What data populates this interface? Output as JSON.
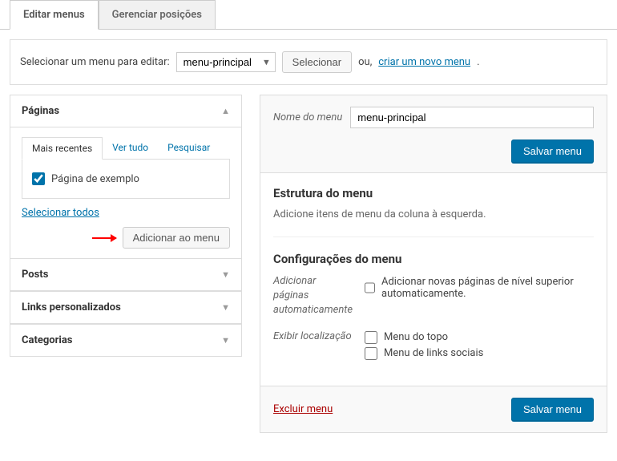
{
  "tabs": {
    "edit": "Editar menus",
    "manage": "Gerenciar posições"
  },
  "selector": {
    "label": "Selecionar um menu para editar:",
    "value": "menu-principal",
    "button": "Selecionar",
    "or": "ou,",
    "createLink": "criar um novo menu",
    "period": "."
  },
  "sidebar": {
    "pages": {
      "title": "Páginas",
      "tabs": {
        "recent": "Mais recentes",
        "all": "Ver tudo",
        "search": "Pesquisar"
      },
      "items": [
        {
          "label": "Página de exemplo"
        }
      ],
      "selectAll": "Selecionar todos",
      "addButton": "Adicionar ao menu"
    },
    "posts": "Posts",
    "customLinks": "Links personalizados",
    "categories": "Categorias"
  },
  "menu": {
    "nameLabel": "Nome do menu",
    "nameValue": "menu-principal",
    "saveButton": "Salvar menu",
    "structure": {
      "title": "Estrutura do menu",
      "desc": "Adicione itens de menu da coluna à esquerda."
    },
    "settings": {
      "title": "Configurações do menu",
      "autoAdd": {
        "label": "Adicionar páginas automaticamente",
        "option": "Adicionar novas páginas de nível superior automaticamente."
      },
      "location": {
        "label": "Exibir localização",
        "options": [
          "Menu do topo",
          "Menu de links sociais"
        ]
      }
    },
    "deleteLink": "Excluir menu"
  }
}
